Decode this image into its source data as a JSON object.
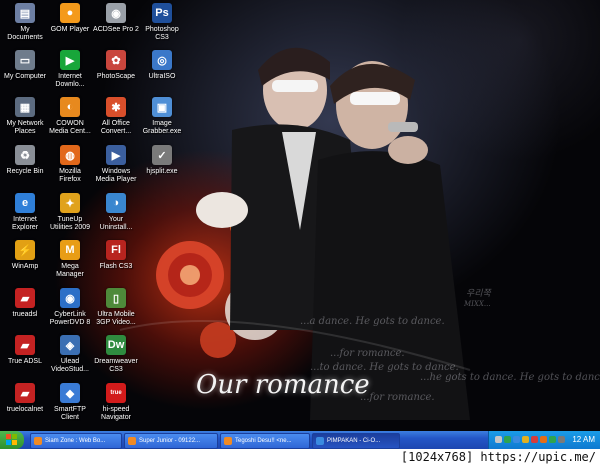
{
  "desktop_icons": [
    {
      "label": "My\nDocuments",
      "icon": "folder-documents-icon",
      "color": "#6d7fa3",
      "glyph": "▤"
    },
    {
      "label": "GOM Player",
      "icon": "gom-player-icon",
      "color": "#f49a1b",
      "glyph": "●"
    },
    {
      "label": "ACDSee Pro 2",
      "icon": "acdsee-icon",
      "color": "#9aa0a8",
      "glyph": "◉"
    },
    {
      "label": "Photoshop\nCS3",
      "icon": "photoshop-icon",
      "color": "#1f4f9a",
      "glyph": "Ps"
    },
    {
      "label": "My Computer",
      "icon": "my-computer-icon",
      "color": "#6f7c8c",
      "glyph": "▭"
    },
    {
      "label": "Internet\nDownlo...",
      "icon": "internet-download-icon",
      "color": "#18a63a",
      "glyph": "▶"
    },
    {
      "label": "PhotoScape",
      "icon": "photoscape-icon",
      "color": "#c9463d",
      "glyph": "✿"
    },
    {
      "label": "UltraISO",
      "icon": "ultraiso-icon",
      "color": "#3b78c9",
      "glyph": "◎"
    },
    {
      "label": "My Network\nPlaces",
      "icon": "network-places-icon",
      "color": "#5c6b80",
      "glyph": "▦"
    },
    {
      "label": "COWON\nMedia Cent...",
      "icon": "cowon-icon",
      "color": "#e7891e",
      "glyph": "◐"
    },
    {
      "label": "All Office\nConvert...",
      "icon": "office-converter-icon",
      "color": "#d94f2b",
      "glyph": "✱"
    },
    {
      "label": "Image\nGrabber.exe",
      "icon": "image-grabber-icon",
      "color": "#4f8fd6",
      "glyph": "▣"
    },
    {
      "label": "Recycle Bin",
      "icon": "recycle-bin-icon",
      "color": "#8a8f97",
      "glyph": "♻"
    },
    {
      "label": "Mozilla\nFirefox",
      "icon": "firefox-icon",
      "color": "#e2681b",
      "glyph": "◍"
    },
    {
      "label": "Windows\nMedia Player",
      "icon": "media-player-icon",
      "color": "#3b5f9e",
      "glyph": "▶"
    },
    {
      "label": "hjsplit.exe",
      "icon": "hjsplit-icon",
      "color": "#7a7a7a",
      "glyph": "✓"
    },
    {
      "label": "Internet\nExplorer",
      "icon": "internet-explorer-icon",
      "color": "#2f7fd8",
      "glyph": "e"
    },
    {
      "label": "TuneUp\nUtilities 2009",
      "icon": "tuneup-icon",
      "color": "#e0a21c",
      "glyph": "✦"
    },
    {
      "label": "Your\nUninstall...",
      "icon": "uninstaller-icon",
      "color": "#3a86cf",
      "glyph": "◑"
    },
    {
      "label": "WinAmp",
      "icon": "winamp-icon",
      "color": "#e2a014",
      "glyph": "⚡"
    },
    {
      "label": "Mega\nManager",
      "icon": "mega-manager-icon",
      "color": "#e89d16",
      "glyph": "M"
    },
    {
      "label": "Flash CS3",
      "icon": "flash-icon",
      "color": "#b8241f",
      "glyph": "Fl"
    },
    {
      "label": "trueadsl",
      "icon": "trueadsl-icon",
      "color": "#c42222",
      "glyph": "▰"
    },
    {
      "label": "CyberLink\nPowerDVD 8",
      "icon": "powerdvd-icon",
      "color": "#2c6fc7",
      "glyph": "◉"
    },
    {
      "label": "Ultra Mobile\n3GP Video...",
      "icon": "ultra-mobile-icon",
      "color": "#4e8a3a",
      "glyph": "▯"
    },
    {
      "label": "True ADSL",
      "icon": "true-adsl-icon",
      "color": "#c42222",
      "glyph": "▰"
    },
    {
      "label": "Ulead\nVideoStud...",
      "icon": "ulead-icon",
      "color": "#3b6fb3",
      "glyph": "◈"
    },
    {
      "label": "Dreamweaver\nCS3",
      "icon": "dreamweaver-icon",
      "color": "#2f8b3f",
      "glyph": "Dw"
    },
    {
      "label": "truelocalnet",
      "icon": "truelocalnet-icon",
      "color": "#c42222",
      "glyph": "▰"
    },
    {
      "label": "SmartFTP\nClient",
      "icon": "smartftp-icon",
      "color": "#3a7bd5",
      "glyph": "◆"
    },
    {
      "label": "hi-speed\nNavigator",
      "icon": "hispeed-navigator-icon",
      "color": "#d21b1b",
      "glyph": "true"
    }
  ],
  "wallpaper": {
    "title": "Our romance",
    "text_lines": [
      "...a dance. He gots to dance.",
      "...to dance. He gots to dance.",
      "...he gots to dance. He gots to dance.",
      "...for romance.",
      "...for romance."
    ],
    "wm_tag": "MIXX...",
    "wm_korean": "우리쭉"
  },
  "taskbar": {
    "start_icon": "windows-start-icon",
    "tasks": [
      {
        "label": "Siam Zone : Web Bo...",
        "active": false
      },
      {
        "label": "Super Junior - 09122...",
        "active": false
      },
      {
        "label": "Tegoshi Desu!! <ne...",
        "active": false
      },
      {
        "label": "PIMPAKAN - Ci-O...",
        "active": true
      }
    ],
    "clock": "12 AM",
    "tray_colors": [
      "#c6c6c6",
      "#2ea44f",
      "#3a8be0",
      "#e0b020",
      "#d63c3c",
      "#e46d18",
      "#2ea44f",
      "#7a7a7a"
    ]
  },
  "credit": "[1024x768] https://upic.me/"
}
